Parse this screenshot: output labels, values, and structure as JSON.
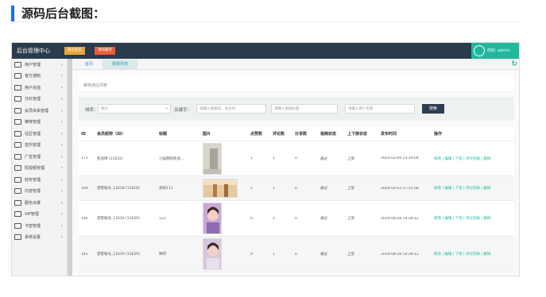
{
  "heading": "源码后台截图：",
  "app": {
    "brand": "后台管理中心",
    "btn_front": "前台首页",
    "btn_clear": "清除缓存",
    "user": "你好, admin"
  },
  "sidebar": {
    "items": [
      {
        "label": "用户管理"
      },
      {
        "label": "官方通知"
      },
      {
        "label": "用户充值"
      },
      {
        "label": "分红管理"
      },
      {
        "label": "会员体系管理"
      },
      {
        "label": "推荐管理"
      },
      {
        "label": "社区管理"
      },
      {
        "label": "音乐管理"
      },
      {
        "label": "广告管理"
      },
      {
        "label": "短视频管理"
      },
      {
        "label": "财务管理"
      },
      {
        "label": "内容管理"
      },
      {
        "label": "服务派遣"
      },
      {
        "label": "VIP管理"
      },
      {
        "label": "卡密管理"
      },
      {
        "label": "系统设置"
      }
    ]
  },
  "tabs": [
    {
      "label": "首页"
    },
    {
      "label": "视频列表"
    }
  ],
  "sub_tab": "审核通过列表",
  "filter": {
    "sort_label": "排序：",
    "sort_value": "默认",
    "keyword_label": "关键字：",
    "ph_id": "请输入视频ID、会员ID",
    "ph_title": "请输入视频标题",
    "ph_user": "请输入用户名称",
    "search": "搜索"
  },
  "table": {
    "headers": [
      "ID",
      "会员昵称（ID）",
      "标题",
      "图片",
      "点赞数",
      "评论数",
      "分享数",
      "视频状态",
      "上下架状态",
      "发布时间",
      "操作"
    ],
    "rows": [
      {
        "id": "171",
        "member": "凯洛特 (11632)",
        "title": "小猫啊呀凯洛...",
        "likes": "1",
        "comments": "1",
        "shares": "0",
        "status": "通过",
        "shelf": "上架",
        "time": "2020-02-09 23:29:04",
        "ops": "修改 | 编辑 | 下架 | 评论列表 | 删除"
      },
      {
        "id": "169",
        "member": "游客账号_11618 (11618)",
        "title": "测试111",
        "likes": "5",
        "comments": "1",
        "shares": "0",
        "status": "通过",
        "shelf": "上架",
        "time": "2020-02-03 17:15:58",
        "ops": "修改 | 编辑 | 下架 | 评论列表 | 删除"
      },
      {
        "id": "146",
        "member": "游客账号_11619 (11629)",
        "title": "123",
        "likes": "0",
        "comments": "1",
        "shares": "0",
        "status": "通过",
        "shelf": "上架",
        "time": "2019-08-28 14:28:12",
        "ops": "修改 | 编辑 | 下架 | 评论列表 | 删除"
      },
      {
        "id": "145",
        "member": "游客账号_11619 (11629)",
        "title": "钟印",
        "likes": "0",
        "comments": "1",
        "shares": "0",
        "status": "通过",
        "shelf": "上架",
        "time": "2019-08-28 14:28:12",
        "ops": "修改 | 编辑 | 下架 | 评论列表 | 删除"
      }
    ]
  },
  "colors": {
    "accent": "#1fb89c",
    "topbar": "#2b3b4e",
    "heading_bar": "#1e6ee8"
  }
}
